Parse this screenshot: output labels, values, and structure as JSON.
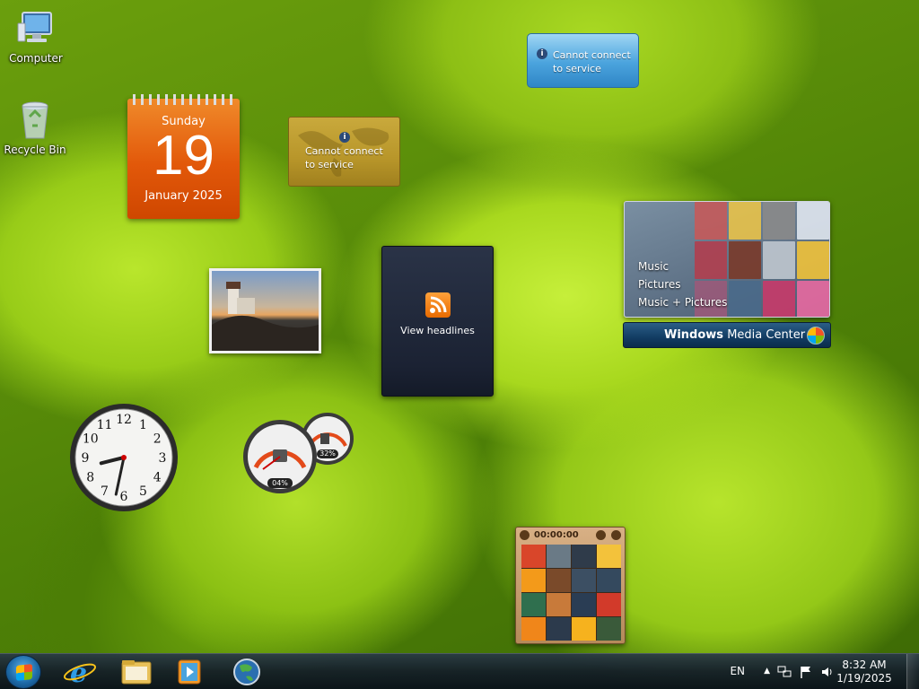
{
  "desktop": {
    "icons": [
      {
        "label": "Computer",
        "icon": "computer-icon"
      },
      {
        "label": "Recycle Bin",
        "icon": "recycle-bin-icon"
      }
    ]
  },
  "calendar": {
    "weekday": "Sunday",
    "day": "19",
    "month_year": "January 2025"
  },
  "weather": {
    "message": "Cannot connect to service",
    "icon": "info-icon"
  },
  "stocks": {
    "message": "Cannot connect to service",
    "icon": "info-icon"
  },
  "feeds": {
    "label": "View headlines",
    "icon": "rss-icon"
  },
  "media_center": {
    "menu": [
      "Music",
      "Pictures",
      "Music + Pictures"
    ],
    "bar_brand": "Windows",
    "bar_product": "Media Center"
  },
  "clock": {
    "hour": 8,
    "minute": 32,
    "numerals": [
      "12",
      "1",
      "2",
      "3",
      "4",
      "5",
      "6",
      "7",
      "8",
      "9",
      "10",
      "11"
    ]
  },
  "cpu_meter": {
    "cpu_percent": "04%",
    "memory_percent": "32%"
  },
  "puzzle": {
    "timer": "00:00:00"
  },
  "taskbar": {
    "apps": [
      "internet-explorer-icon",
      "windows-explorer-icon",
      "media-player-icon",
      "browser-globe-icon"
    ],
    "language": "EN",
    "time": "8:32 AM",
    "date": "1/19/2025"
  },
  "colors": {
    "accent": "#1e6aa8",
    "calendar": "#e2580a",
    "wallpaper": "#98cc18"
  }
}
